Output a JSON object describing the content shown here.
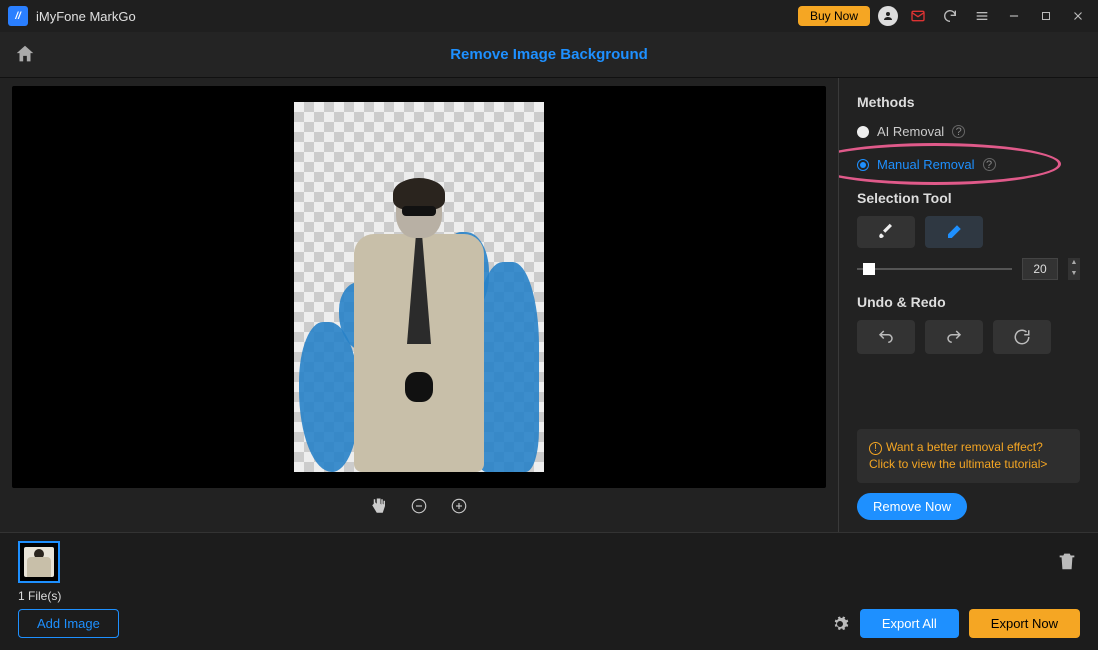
{
  "app": {
    "title": "iMyFone MarkGo"
  },
  "titlebar": {
    "buy_label": "Buy Now"
  },
  "header": {
    "page_title": "Remove Image Background"
  },
  "sidebar": {
    "methods_title": "Methods",
    "methods": {
      "ai": "AI Removal",
      "manual": "Manual Removal",
      "selected": "manual"
    },
    "selection_title": "Selection Tool",
    "brush_size": 20,
    "undo_title": "Undo & Redo",
    "tip_text": "Want a better removal effect? Click to view the ultimate tutorial>",
    "remove_now": "Remove Now"
  },
  "bottom": {
    "file_count": "1 File(s)",
    "add_image": "Add Image",
    "export_all": "Export All",
    "export_now": "Export Now"
  }
}
